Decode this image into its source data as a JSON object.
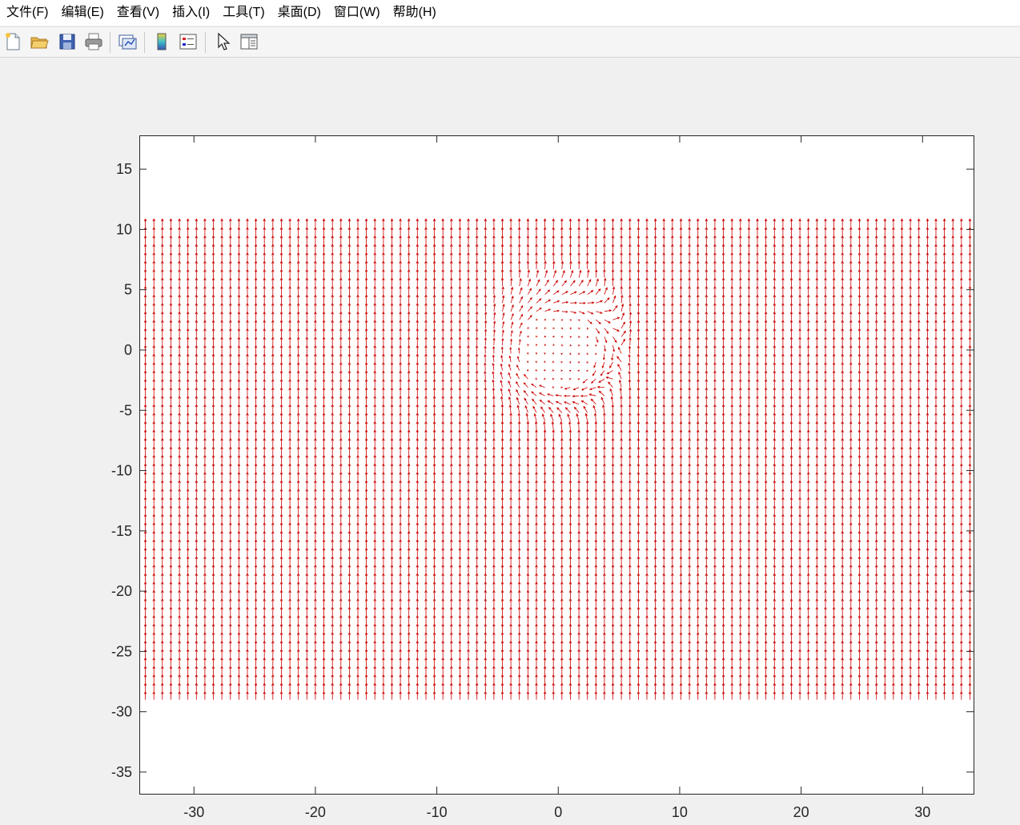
{
  "menubar": {
    "items": [
      {
        "label": "文件(F)"
      },
      {
        "label": "编辑(E)"
      },
      {
        "label": "查看(V)"
      },
      {
        "label": "插入(I)"
      },
      {
        "label": "工具(T)"
      },
      {
        "label": "桌面(D)"
      },
      {
        "label": "窗口(W)"
      },
      {
        "label": "帮助(H)"
      }
    ]
  },
  "toolbar": {
    "buttons": [
      {
        "icon": "new-figure-icon"
      },
      {
        "icon": "open-file-icon"
      },
      {
        "icon": "save-icon"
      },
      {
        "icon": "print-icon"
      },
      {
        "icon": "link-plot-icon"
      },
      {
        "icon": "insert-colorbar-icon"
      },
      {
        "icon": "insert-legend-icon"
      },
      {
        "icon": "edit-plot-pointer-icon"
      },
      {
        "icon": "property-inspector-icon"
      }
    ]
  },
  "chart_data": {
    "type": "quiver",
    "title": "",
    "xlabel": "",
    "ylabel": "",
    "xlim": [
      -34.5,
      34.2
    ],
    "ylim": [
      -36.8,
      17.8
    ],
    "xticks": [
      -30,
      -20,
      -10,
      0,
      10,
      20,
      30
    ],
    "yticks": [
      15,
      10,
      5,
      0,
      -5,
      -10,
      -15,
      -20,
      -25,
      -30,
      -35
    ],
    "xtick_labels": [
      "-30",
      "-20",
      "-10",
      "0",
      "10",
      "20",
      "30"
    ],
    "ytick_labels": [
      "15",
      "10",
      "5",
      "0",
      "-5",
      "-10",
      "-15",
      "-20",
      "-25",
      "-30",
      "-35"
    ],
    "grid": false,
    "arrow_color": "#cc0000",
    "vector_field": {
      "x_range": [
        -34,
        34
      ],
      "y_range": [
        -29,
        10.5
      ],
      "spacing": 0.7,
      "uniform_direction": [
        0,
        1
      ],
      "vortex_center": [
        0,
        0
      ],
      "vortex_inner_radius": 3.2,
      "vortex_outer_radius": 7
    }
  }
}
